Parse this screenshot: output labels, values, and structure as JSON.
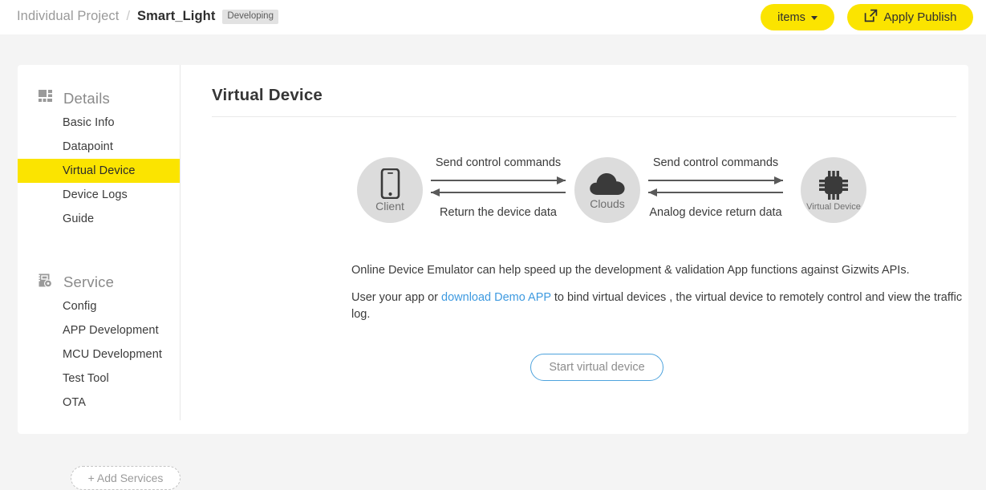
{
  "header": {
    "breadcrumb_root": "Individual Project",
    "breadcrumb_separator": "/",
    "breadcrumb_current": "Smart_Light",
    "status_badge": "Developing",
    "items_button": "items",
    "apply_publish_button": "Apply Publish",
    "accent_color": "#fbe400"
  },
  "sidebar": {
    "groups": [
      {
        "title": "Details",
        "icon": "dashboard-grid-icon",
        "items": [
          {
            "label": "Basic Info",
            "active": false
          },
          {
            "label": "Datapoint",
            "active": false
          },
          {
            "label": "Virtual Device",
            "active": true
          },
          {
            "label": "Device Logs",
            "active": false
          },
          {
            "label": "Guide",
            "active": false
          }
        ]
      },
      {
        "title": "Service",
        "icon": "server-gear-icon",
        "items": [
          {
            "label": "Config",
            "active": false
          },
          {
            "label": "APP Development",
            "active": false
          },
          {
            "label": "MCU Development",
            "active": false
          },
          {
            "label": "Test Tool",
            "active": false
          },
          {
            "label": "OTA",
            "active": false
          }
        ]
      }
    ],
    "add_services_button": "+ Add Services",
    "active_highlight_color": "#fbe400"
  },
  "main": {
    "page_title": "Virtual Device",
    "diagram": {
      "nodes": [
        {
          "label": "Client",
          "icon": "smartphone-icon"
        },
        {
          "label": "Clouds",
          "icon": "cloud-icon"
        },
        {
          "label": "Virtual Device",
          "icon": "microchip-icon"
        }
      ],
      "links": [
        {
          "top_label": "Send control commands",
          "bottom_label": "Return the device data"
        },
        {
          "top_label": "Send control commands",
          "bottom_label": "Analog device return data"
        }
      ]
    },
    "paragraph_1": "Online Device Emulator can help speed up the development & validation App functions against Gizwits APIs.",
    "paragraph_2_before": "User your app or ",
    "paragraph_2_link": "download Demo APP",
    "paragraph_2_after": " to bind virtual devices , the virtual device to remotely control and view the traffic log.",
    "start_button": "Start virtual device",
    "link_color": "#3e9ae0"
  }
}
